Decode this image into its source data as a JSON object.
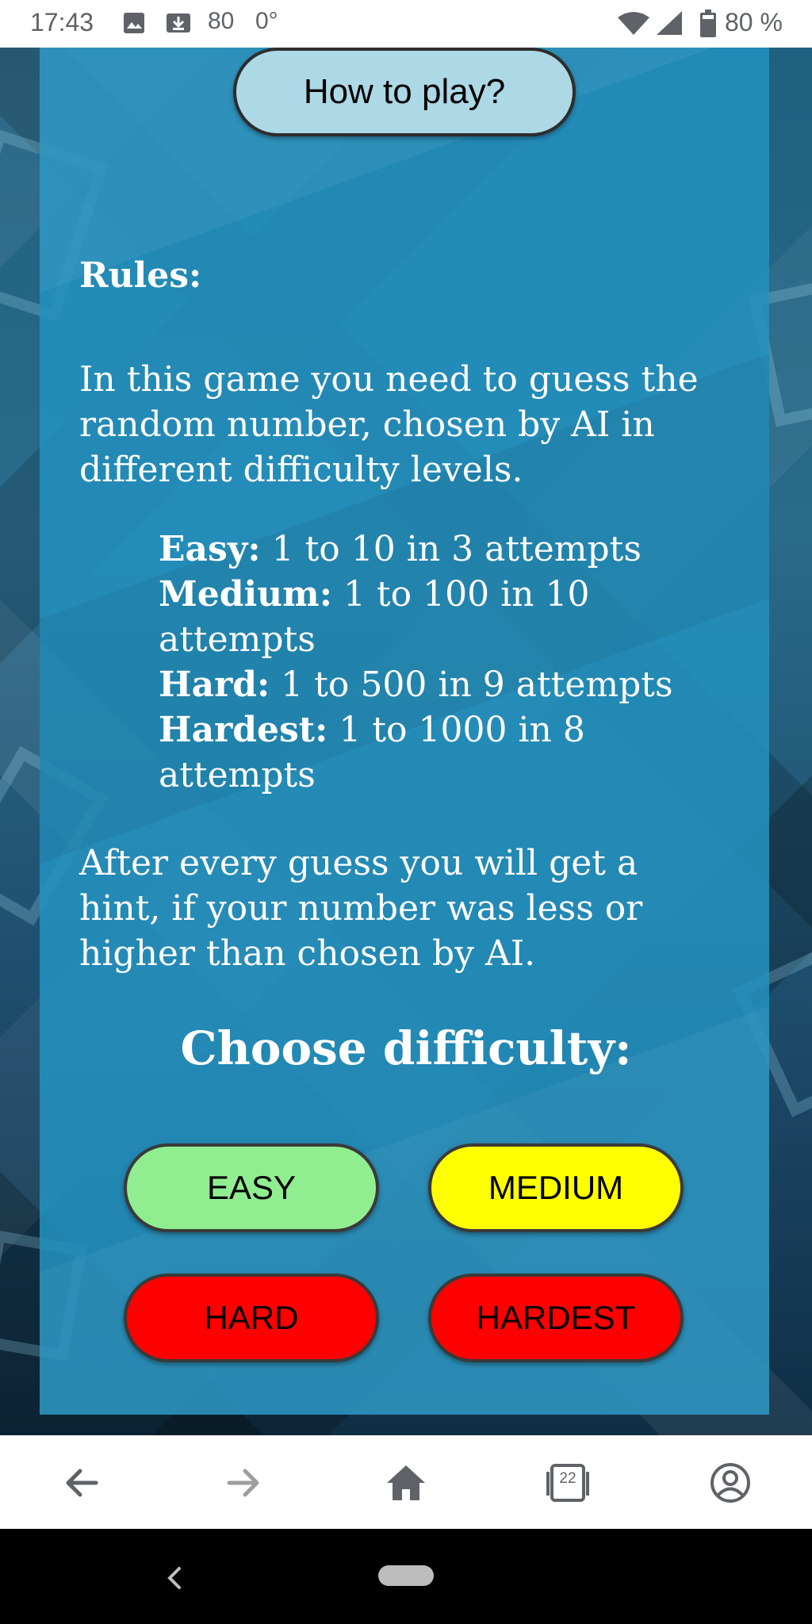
{
  "status_bar": {
    "time": "17:43",
    "notification_value": "80",
    "temperature": "0°",
    "battery_percent": "80 %"
  },
  "page": {
    "how_to_play_button": "How to play?",
    "rules_title": "Rules:",
    "intro": "In this game you need to guess the random number, chosen by AI in different difficulty levels.",
    "levels": [
      {
        "name": "Easy:",
        "desc": " 1 to 10 in 3 attempts"
      },
      {
        "name": "Medium:",
        "desc": " 1 to 100 in 10 attempts"
      },
      {
        "name": "Hard:",
        "desc": " 1 to 500 in 9 attempts"
      },
      {
        "name": "Hardest:",
        "desc": " 1 to 1000 in 8 attempts"
      }
    ],
    "hint": "After every guess you will get a hint, if your number was less or higher than chosen by AI.",
    "choose_title": "Choose difficulty:",
    "buttons": {
      "easy": "EASY",
      "medium": "MEDIUM",
      "hard": "HARD",
      "hardest": "HARDEST"
    },
    "colors": {
      "how_to_play_bg": "#add8e6",
      "easy_bg": "#90ee90",
      "medium_bg": "#ffff00",
      "hard_bg": "#ff0000",
      "hardest_bg": "#ff0000",
      "panel_bg": "#2391be"
    }
  },
  "browser_toolbar": {
    "tab_count": "22",
    "icons": [
      "back-arrow-icon",
      "forward-arrow-icon",
      "home-icon",
      "tabs-icon",
      "account-icon"
    ]
  }
}
